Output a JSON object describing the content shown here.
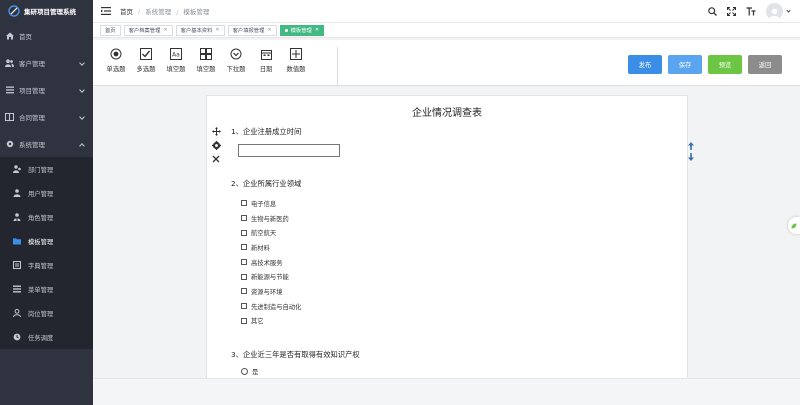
{
  "app": {
    "title": "集研项目管理系统"
  },
  "sidebar": {
    "menu": [
      {
        "label": "首页",
        "icon": "home-icon"
      },
      {
        "label": "客户管理",
        "icon": "users-icon"
      },
      {
        "label": "项目管理",
        "icon": "list-icon"
      },
      {
        "label": "合同管理",
        "icon": "book-icon"
      },
      {
        "label": "系统管理",
        "icon": "gear-icon"
      }
    ],
    "system_submenu": [
      {
        "label": "部门管理",
        "icon": "org-icon"
      },
      {
        "label": "用户管理",
        "icon": "user-icon"
      },
      {
        "label": "角色管理",
        "icon": "role-icon"
      },
      {
        "label": "模板管理",
        "icon": "folder-icon"
      },
      {
        "label": "字典管理",
        "icon": "dict-icon"
      },
      {
        "label": "菜单管理",
        "icon": "menu-icon"
      },
      {
        "label": "岗位管理",
        "icon": "post-icon"
      },
      {
        "label": "任务调度",
        "icon": "clock-icon"
      }
    ],
    "active_item": "模板管理"
  },
  "header": {
    "breadcrumb": [
      "首页",
      "系统管理",
      "模板管理"
    ]
  },
  "tabs": [
    {
      "label": "首页"
    },
    {
      "label": "客户档案管理"
    },
    {
      "label": "客户基本资料"
    },
    {
      "label": "客户填报管理"
    },
    {
      "label": "模板管理",
      "active": true
    }
  ],
  "toolbar": {
    "tools": [
      {
        "label": "单选题",
        "icon": "radio-icon"
      },
      {
        "label": "多选题",
        "icon": "checkbox-icon"
      },
      {
        "label": "填空题",
        "icon": "text-icon"
      },
      {
        "label": "填空题",
        "icon": "multi-blank-icon"
      },
      {
        "label": "下拉题",
        "icon": "dropdown-icon"
      },
      {
        "label": "日期",
        "icon": "calendar-icon"
      },
      {
        "label": "数值题",
        "icon": "number-icon"
      }
    ],
    "buttons": {
      "publish": "发布",
      "save": "保存",
      "preview": "预览",
      "back": "返回"
    },
    "colors": {
      "publish": "#3a8ee6",
      "save": "#5aa4f0",
      "preview": "#6cc644",
      "back": "#8c8c8c"
    }
  },
  "survey": {
    "title": "企业情况调查表",
    "q1": {
      "label": "1、企业注册成立时间"
    },
    "q2": {
      "label": "2、企业所属行业领域",
      "options": [
        "电子信息",
        "生物与新医药",
        "航空航天",
        "新材料",
        "高技术服务",
        "新能源与节能",
        "资源与环境",
        "先进制造与自动化",
        "其它"
      ]
    },
    "q3": {
      "label": "3、企业近三年是否有取得有效知识产权",
      "options": [
        "是"
      ]
    }
  }
}
